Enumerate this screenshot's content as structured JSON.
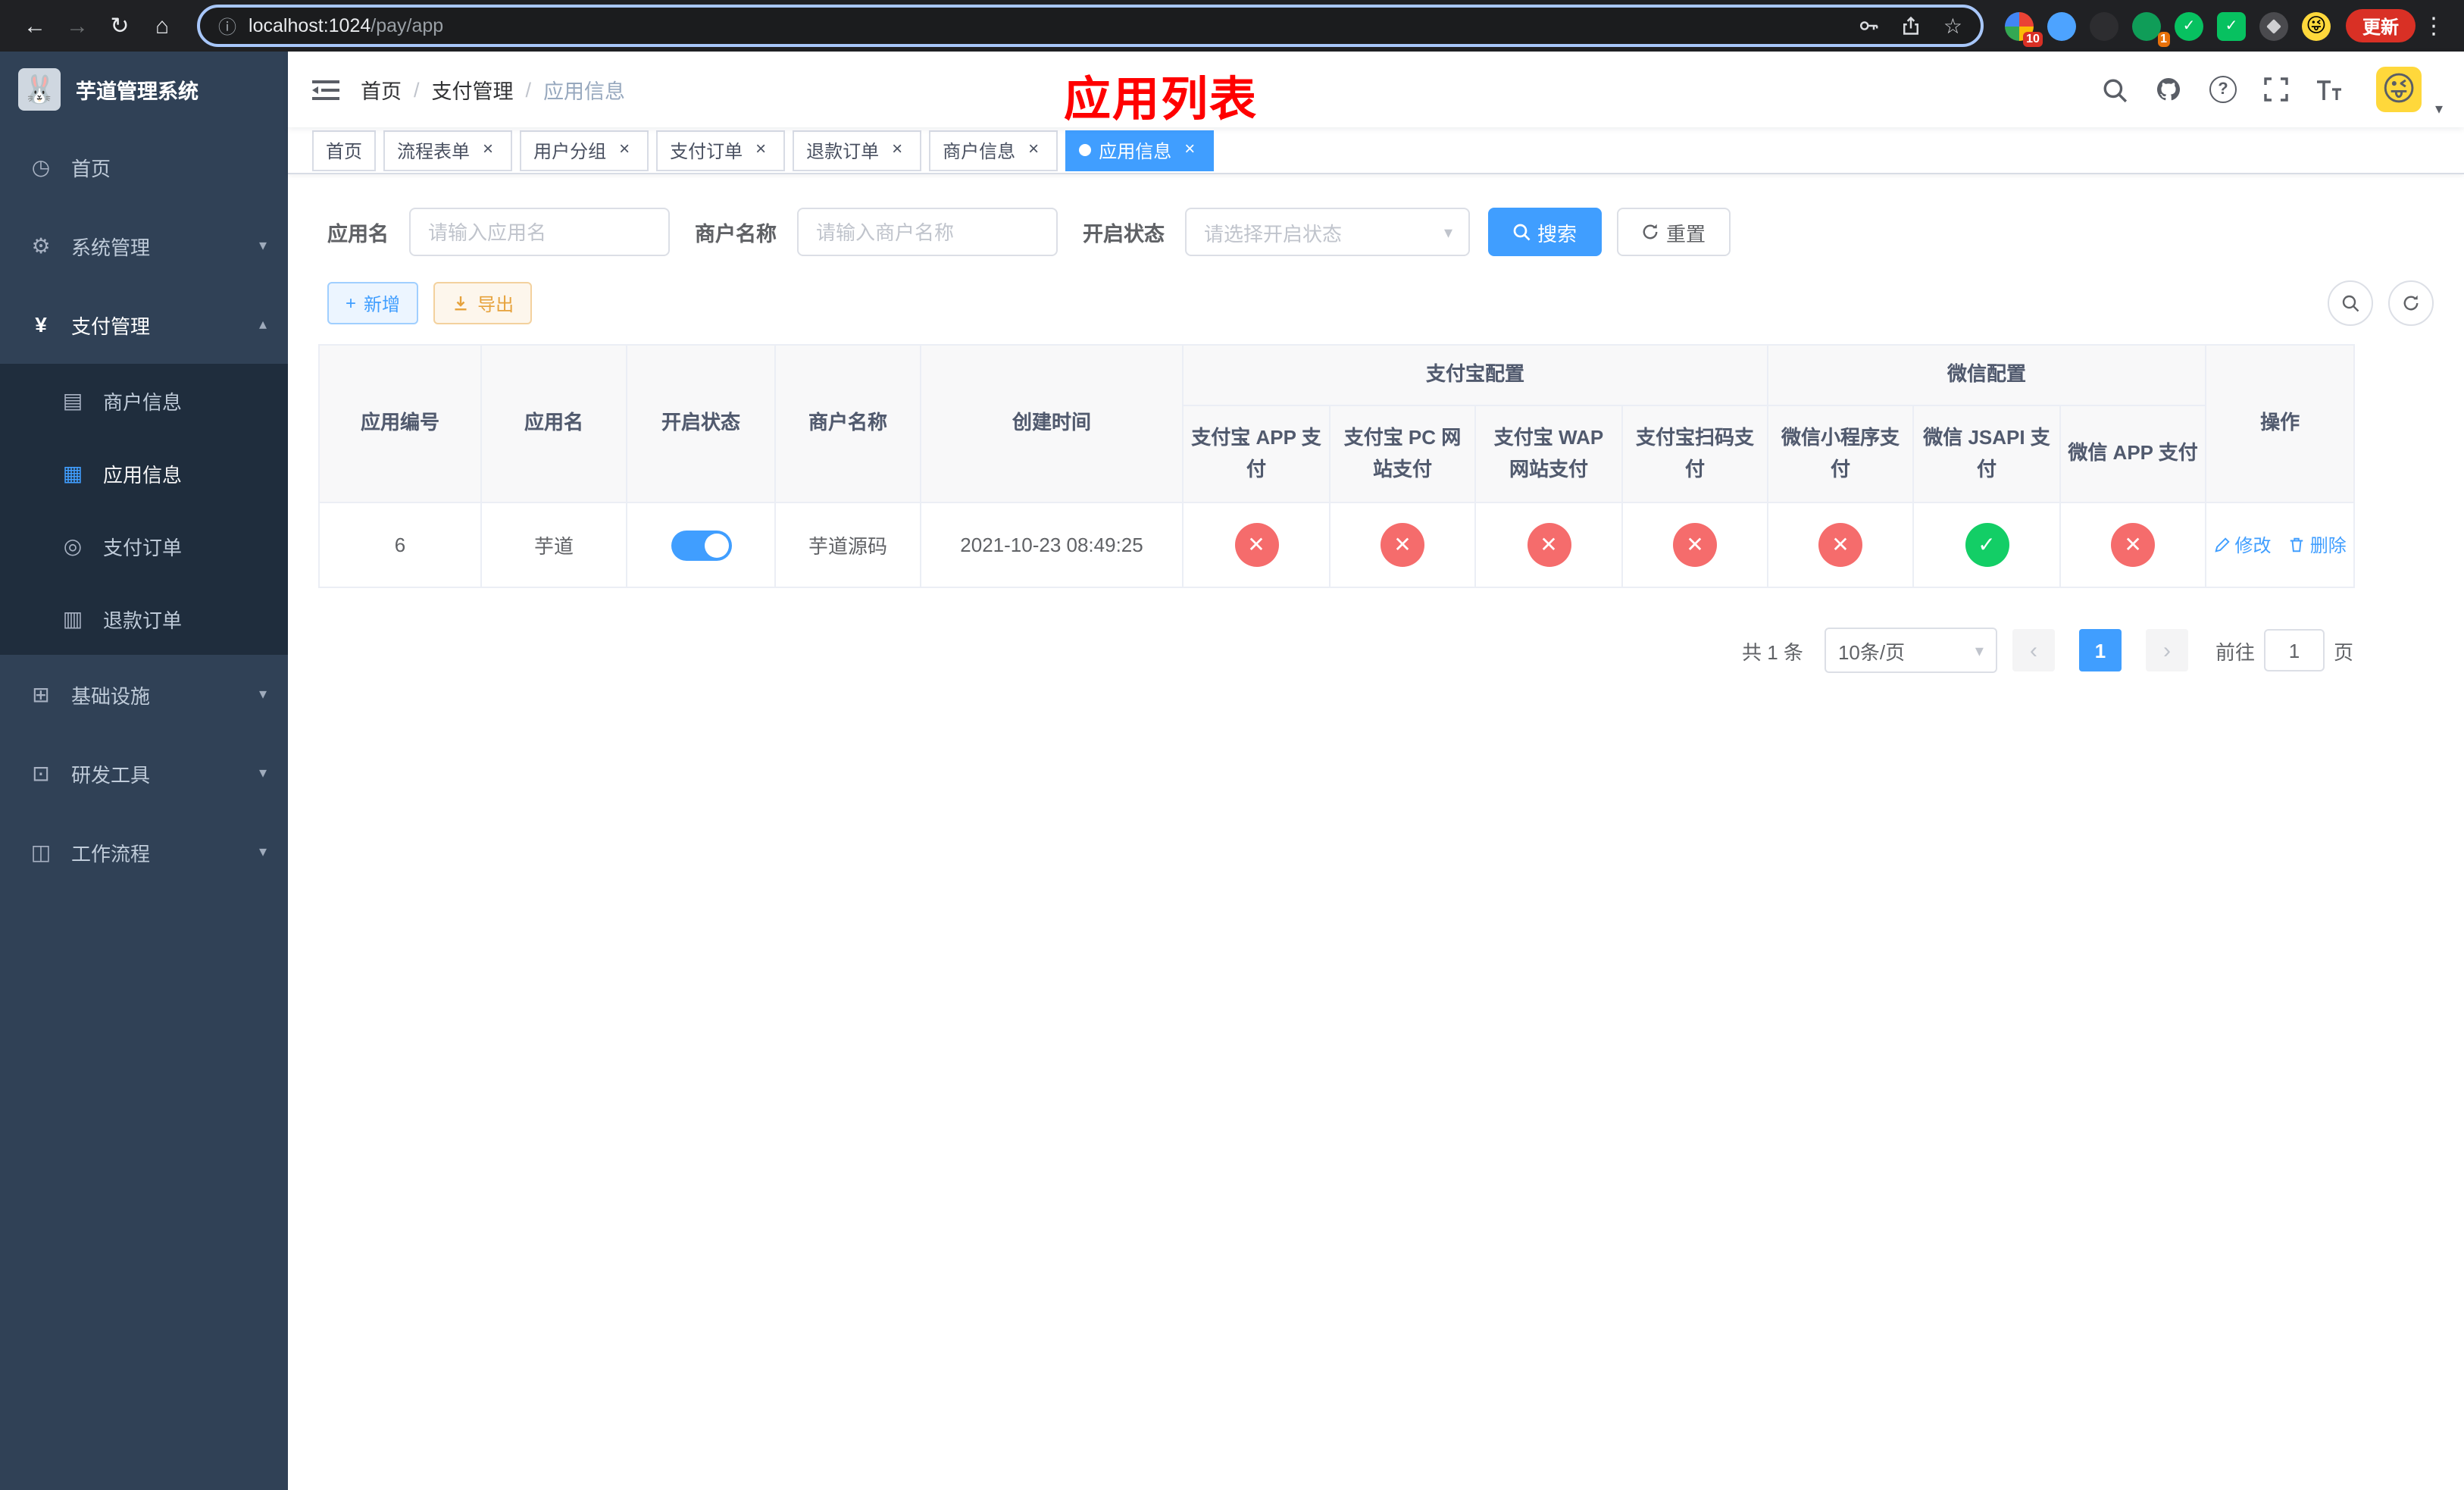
{
  "icons": {
    "back": "←",
    "forward": "→",
    "reload": "↻",
    "home": "⌂",
    "info": "ⓘ",
    "star": "☆",
    "menu_dots": "⋮",
    "dashboard": "◷",
    "gear": "⚙",
    "yen": "¥",
    "card": "▤",
    "grid": "▦",
    "order": "◎",
    "refund": "▥",
    "infra": "⊞",
    "tools": "⊡",
    "flow": "◫",
    "chevron_down": "▾",
    "chevron_up": "▴",
    "caret_down": "▾",
    "plus": "+",
    "close": "×",
    "check": "✓",
    "cross": "✕",
    "question": "?",
    "slash": "/",
    "prev": "‹",
    "next": "›",
    "wechat_mark": "✓",
    "face": "😜",
    "rabbit": "🐰"
  },
  "browser": {
    "url_host": "localhost:1024",
    "url_path": "/pay/app",
    "update_label": "更新",
    "extension_badges": {
      "first": "10",
      "fourth": "1"
    }
  },
  "sidebar": {
    "title": "芋道管理系统",
    "items": [
      {
        "label": "首页"
      },
      {
        "label": "系统管理"
      },
      {
        "label": "支付管理"
      },
      {
        "label": "商户信息"
      },
      {
        "label": "应用信息"
      },
      {
        "label": "支付订单"
      },
      {
        "label": "退款订单"
      },
      {
        "label": "基础设施"
      },
      {
        "label": "研发工具"
      },
      {
        "label": "工作流程"
      }
    ]
  },
  "navbar": {
    "breadcrumb": [
      "首页",
      "支付管理",
      "应用信息"
    ],
    "annotation": "应用列表"
  },
  "tabs": [
    {
      "label": "首页"
    },
    {
      "label": "流程表单"
    },
    {
      "label": "用户分组"
    },
    {
      "label": "支付订单"
    },
    {
      "label": "退款订单"
    },
    {
      "label": "商户信息"
    },
    {
      "label": "应用信息"
    }
  ],
  "filters": {
    "app_name_label": "应用名",
    "app_name_placeholder": "请输入应用名",
    "app_name_value": "",
    "merchant_label": "商户名称",
    "merchant_placeholder": "请输入商户名称",
    "merchant_value": "",
    "status_label": "开启状态",
    "status_placeholder": "请选择开启状态",
    "search_label": "搜索",
    "reset_label": "重置"
  },
  "toolbar": {
    "add_label": "新增",
    "export_label": "导出"
  },
  "table": {
    "groups": {
      "alipay": "支付宝配置",
      "wechat": "微信配置"
    },
    "columns": [
      "应用编号",
      "应用名",
      "开启状态",
      "商户名称",
      "创建时间",
      "支付宝 APP 支付",
      "支付宝 PC 网站支付",
      "支付宝 WAP 网站支付",
      "支付宝扫码支付",
      "微信小程序支付",
      "微信 JSAPI 支付",
      "微信 APP 支付",
      "操作"
    ],
    "row": {
      "id": "6",
      "name": "芋道",
      "enabled": true,
      "merchant": "芋道源码",
      "created_at": "2021-10-23 08:49:25",
      "statuses": [
        "fail",
        "fail",
        "fail",
        "fail",
        "fail",
        "ok",
        "fail"
      ],
      "edit_label": "修改",
      "delete_label": "删除"
    }
  },
  "pagination": {
    "total": "共 1 条",
    "page_size": "10条/页",
    "page": "1",
    "goto_label": "前往",
    "goto_value": "1",
    "unit_label": "页"
  },
  "colors": {
    "accent": "#409EFF",
    "danger": "#F56C6C",
    "success": "#13CE66",
    "annotation": "#FF0000"
  }
}
